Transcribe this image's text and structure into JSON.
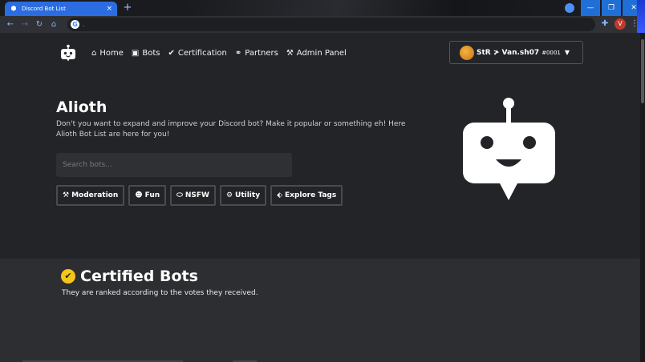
{
  "browser": {
    "tab_title": "Discord Bot List",
    "tab_close": "×",
    "new_tab": "+",
    "url": ".",
    "avatar_letter": "V",
    "window": {
      "minimize": "—",
      "maximize": "❐",
      "close": "✕"
    }
  },
  "navbar": {
    "items": [
      {
        "label": "Home",
        "icon": "home-icon"
      },
      {
        "label": "Bots",
        "icon": "robot-icon"
      },
      {
        "label": "Certification",
        "icon": "check-badge-icon"
      },
      {
        "label": "Partners",
        "icon": "handshake-icon"
      },
      {
        "label": "Admin Panel",
        "icon": "hammer-icon"
      }
    ],
    "user": {
      "name": "StR ≯ Van.sh07",
      "tag": "#0001"
    }
  },
  "hero": {
    "title": "Alioth",
    "description": "Don't you want to expand and improve your Discord bot? Make it popular or something eh! Here Alioth Bot List are here for you!",
    "search_placeholder": "Search bots...",
    "tags": [
      {
        "label": "Moderation",
        "icon": "hammer-icon"
      },
      {
        "label": "Fun",
        "icon": "smile-icon"
      },
      {
        "label": "NSFW",
        "icon": "lips-icon"
      },
      {
        "label": "Utility",
        "icon": "cogs-icon"
      },
      {
        "label": "Explore Tags",
        "icon": "tags-icon"
      }
    ]
  },
  "certified": {
    "title": "Certified Bots",
    "subtitle": "They are ranked according to the votes they received."
  },
  "colors": {
    "hero_bg": "#232427",
    "section_bg": "#2d2e31",
    "tab_blue": "#2b6de0",
    "badge_yellow": "#f5c518"
  }
}
